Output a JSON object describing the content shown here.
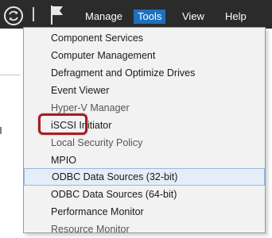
{
  "menubar": {
    "items": [
      {
        "label": "Manage",
        "active": false
      },
      {
        "label": "Tools",
        "active": true
      },
      {
        "label": "View",
        "active": false
      },
      {
        "label": "Help",
        "active": false
      }
    ],
    "icons": {
      "refresh": "refresh-icon",
      "flag": "notifications-flag-icon"
    },
    "colors": {
      "bar": "#2b2b2b",
      "active_bg": "#1f6fbf"
    }
  },
  "tools_menu": {
    "items": [
      {
        "label": "Component Services"
      },
      {
        "label": "Computer Management"
      },
      {
        "label": "Defragment and Optimize Drives"
      },
      {
        "label": "Event Viewer"
      },
      {
        "label": "Hyper-V Manager"
      },
      {
        "label": "iSCSI Initiator",
        "annotated": true
      },
      {
        "label": "Local Security Policy"
      },
      {
        "label": "MPIO"
      },
      {
        "label": "ODBC Data Sources (32-bit)",
        "highlighted": true
      },
      {
        "label": "ODBC Data Sources (64-bit)"
      },
      {
        "label": "Performance Monitor"
      },
      {
        "label": "Resource Monitor"
      }
    ]
  },
  "annotation": {
    "color": "#a71d24"
  }
}
